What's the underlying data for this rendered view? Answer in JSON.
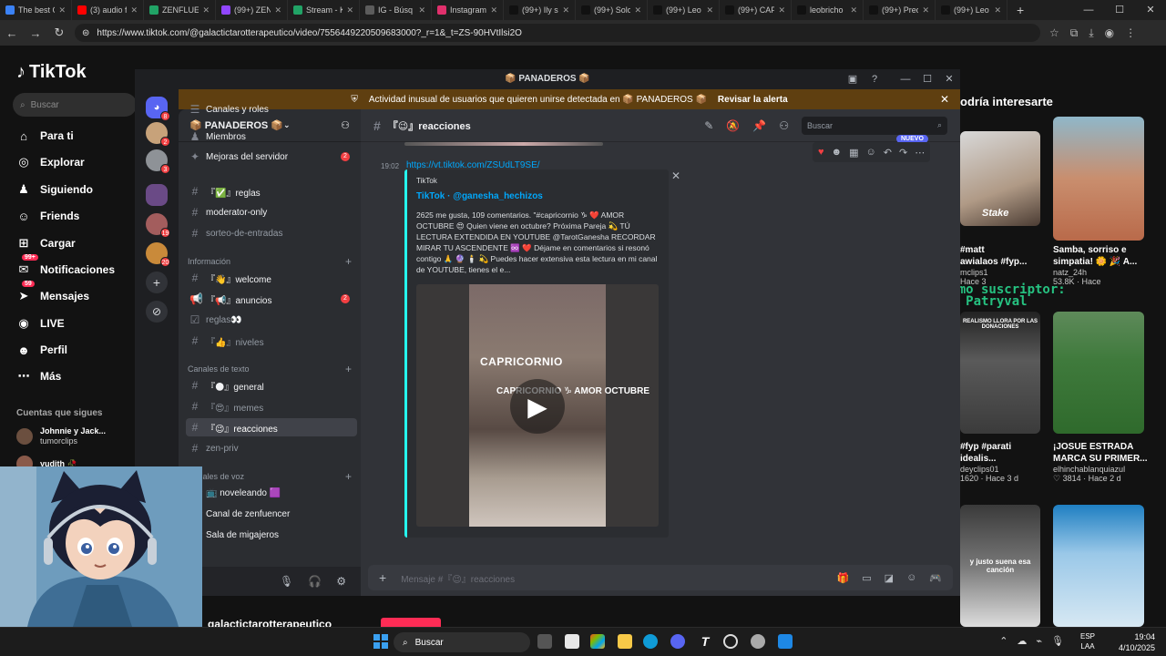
{
  "browser": {
    "tabs": [
      {
        "label": "The best C",
        "color": "#3b82f6"
      },
      {
        "label": "(3) audio f",
        "color": "#ff0000"
      },
      {
        "label": "ZENFLUEN",
        "color": "#21a366"
      },
      {
        "label": "(99+) ZENF",
        "color": "#9146ff"
      },
      {
        "label": "Stream - K",
        "color": "#21a366"
      },
      {
        "label": "IG - Búsq",
        "color": "#5c5c5c"
      },
      {
        "label": "Instagram",
        "color": "#e1306c"
      },
      {
        "label": "(99+) Ily s",
        "color": "#111111"
      },
      {
        "label": "(99+) Solo",
        "color": "#111111"
      },
      {
        "label": "(99+) Leo",
        "color": "#111111"
      },
      {
        "label": "(99+) CAPI",
        "color": "#111111"
      },
      {
        "label": "leobricho",
        "color": "#111111"
      },
      {
        "label": "(99+) Pred",
        "color": "#111111"
      },
      {
        "label": "(99+) Leo",
        "color": "#111111"
      }
    ],
    "url": "https://www.tiktok.com/@galactictarotterapeutico/video/7556449220509683000?_r=1&_t=ZS-90HVtIlsi2O"
  },
  "tiktok": {
    "logo": "TikTok",
    "search_placeholder": "Buscar",
    "nav": [
      {
        "label": "Para ti",
        "icon": "⌂"
      },
      {
        "label": "Explorar",
        "icon": "◎"
      },
      {
        "label": "Siguiendo",
        "icon": "♟"
      },
      {
        "label": "Friends",
        "icon": "☺"
      },
      {
        "label": "Cargar",
        "icon": "⊞"
      },
      {
        "label": "Notificaciones",
        "icon": "✉",
        "badge": "99+"
      },
      {
        "label": "Mensajes",
        "icon": "➤",
        "badge": "59"
      },
      {
        "label": "LIVE",
        "icon": "◉"
      },
      {
        "label": "Perfil",
        "icon": "☻"
      },
      {
        "label": "Más",
        "icon": "⋯"
      }
    ],
    "following_title": "Cuentas que sigues",
    "following": [
      {
        "name": "Johnnie y Jack...",
        "handle": "tumorclips"
      },
      {
        "name": "yudith 🥀",
        "handle": ""
      }
    ],
    "right_title": "odría interesarte",
    "videos": [
      {
        "caption1": "#matt",
        "caption2": "awialaos #fyp...",
        "user": "mclips1",
        "meta": "Hace 3"
      },
      {
        "caption1": "Samba, sorriso e",
        "caption2": "simpatia! 🌼 🎉 A...",
        "user": "natz_24h",
        "meta": "53.8K · Hace"
      },
      {
        "caption1": "#fyp #parati",
        "caption2": "idealis...",
        "user": "deyclips01",
        "meta": "1620 · Hace 3 d"
      },
      {
        "caption1": "¡JOSUE ESTRADA",
        "caption2": "MARCA SU PRIMER...",
        "user": "elhinchablanquiazul",
        "meta": "♡ 3814 · Hace 2 d"
      }
    ],
    "thumb_texts": [
      "Stake",
      "REALISMO LLORA POR LAS DONACIONES",
      "y justo suena esa canción"
    ],
    "overlay_line1": "último suscriptor:",
    "overlay_line2": "Patryval",
    "underlay_handle": "galactictarotterapeutico"
  },
  "discord": {
    "window_title": "📦 PANADEROS 📦",
    "alert_text": "Actividad inusual de usuarios que quieren unirse detectada en 📦 PANADEROS 📦",
    "alert_button": "Revisar la alerta",
    "server_name": "📦 PANADEROS 📦",
    "server_badges": [
      "8",
      "2",
      "3",
      "19",
      "20"
    ],
    "channels_top": [
      {
        "label": "Canales y roles",
        "icon": "☰"
      },
      {
        "label": "Miembros",
        "icon": "♟"
      },
      {
        "label": "Mejoras del servidor",
        "icon": "✦",
        "count": "2"
      }
    ],
    "channels_a": [
      {
        "label": "『✅』reglas",
        "icon": "#",
        "bright": true
      },
      {
        "label": "moderator-only",
        "icon": "#",
        "bright": true
      },
      {
        "label": "sorteo-de-entradas",
        "icon": "#",
        "bright": false
      }
    ],
    "cat_info": "Información",
    "channels_info": [
      {
        "label": "『👋』welcome",
        "icon": "#",
        "bright": true
      },
      {
        "label": "『📢』anuncios",
        "icon": "📢",
        "bright": true,
        "count": "2"
      },
      {
        "label": "reglas👀",
        "icon": "☑",
        "bright": false
      },
      {
        "label": "『👍』niveles",
        "icon": "#",
        "bright": false
      }
    ],
    "cat_text": "Canales de texto",
    "channels_text": [
      {
        "label": "『🌑』general",
        "icon": "#",
        "bright": true
      },
      {
        "label": "『😍』memes",
        "icon": "#",
        "bright": false
      },
      {
        "label": "『😉』reacciones",
        "icon": "#",
        "bright": true,
        "active": true
      },
      {
        "label": "zen-priv",
        "icon": "#",
        "bright": false
      }
    ],
    "cat_voice": "Canales de voz",
    "channels_voice": [
      {
        "label": "📺 noveleando 🟪",
        "icon": "🔊"
      },
      {
        "label": "Canal de zenfuencer",
        "icon": "🔊"
      },
      {
        "label": "Sala de migajeros",
        "icon": "🔊"
      }
    ],
    "current_channel": "『😉』reacciones",
    "search_placeholder": "Buscar",
    "message": {
      "time": "19:02",
      "link": "https://vt.tiktok.com/ZSUdLT9SE/",
      "new_badge": "NUEVO",
      "embed_provider": "TikTok",
      "embed_title": "TikTok · @ganesha_hechizos",
      "embed_description": "2625 me gusta, 109 comentarios. \"#capricornio ♑ ❤️ AMOR OCTUBRE 😍 Quien viene en octubre? Próxima Pareja 💫 TÚ LECTURA EXTENDIDA EN YOUTUBE @TarotGanesha RECORDAR MIRAR TU ASCENDENTE ♾️ ❤️ Déjame en comentarios si resonó contigo 🙏 🔮 🕯️ 💫 Puedes hacer extensiva esta lectura en mi canal de YOUTUBE, tienes el e...",
      "video_label": "CAPRICORNIO",
      "video_sub": "CAPRICORNIO ♑ AMOR OCTUBRE"
    },
    "input_placeholder": "Mensaje #『😉』reacciones"
  },
  "taskbar": {
    "search": "Buscar",
    "lang_top": "ESP",
    "lang_bottom": "LAA",
    "time": "19:04",
    "date": "4/10/2025"
  }
}
